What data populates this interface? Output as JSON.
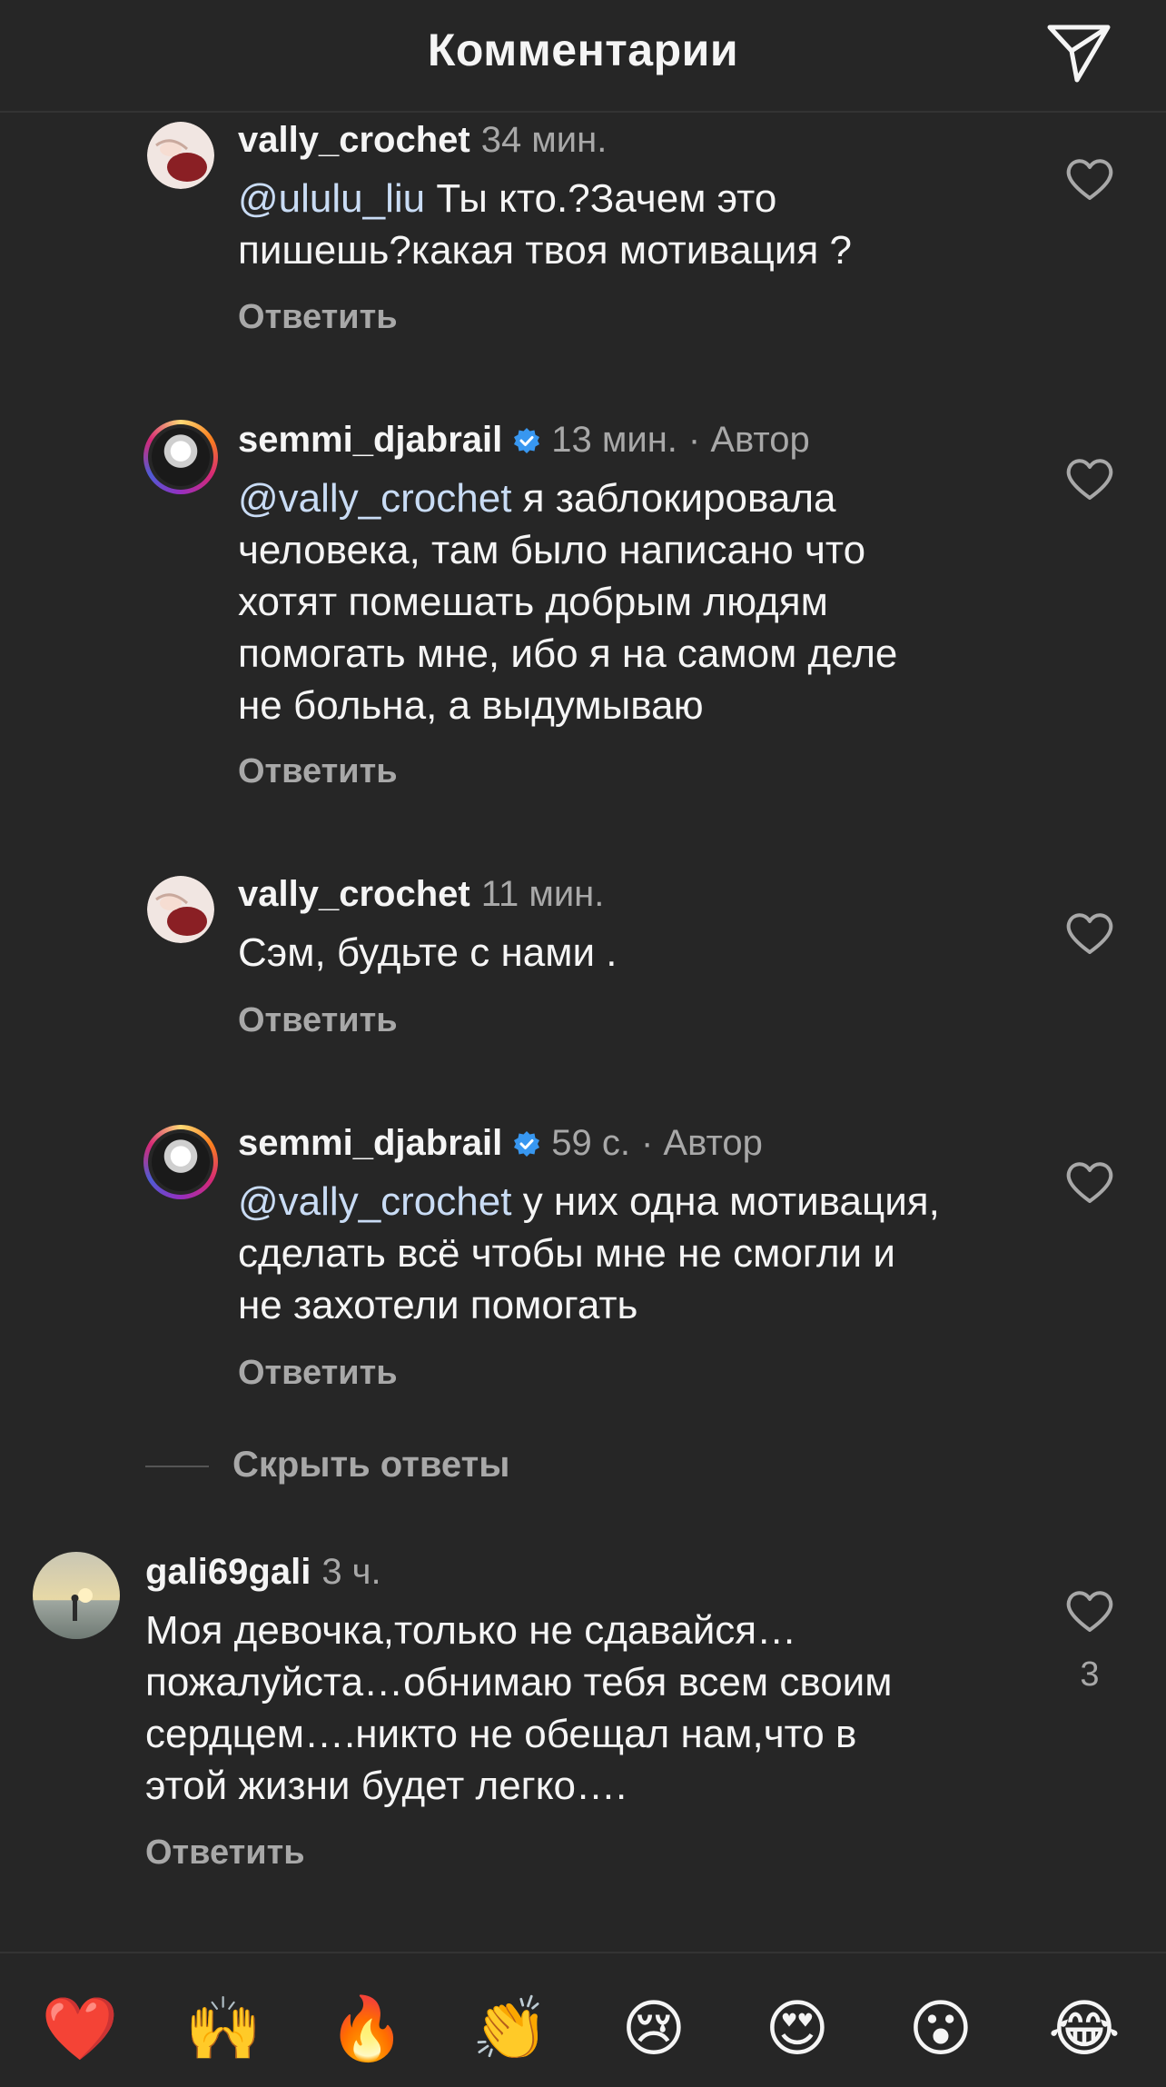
{
  "header": {
    "title": "Комментарии",
    "send_icon": "paper-plane-icon"
  },
  "comments": [
    {
      "username": "vally_crochet",
      "time": "34 мин.",
      "verified": false,
      "author_tag": "",
      "mention": "@ululu_liu",
      "lines": [
        "Ты кто.?Зачем это",
        "пишешь?какая твоя мотивация ?"
      ],
      "reply": "Ответить"
    },
    {
      "username": "semmi_djabrail",
      "time": "13 мин.",
      "verified": true,
      "author_tag": "· Автор",
      "mention": "@vally_crochet",
      "lines": [
        "я заблокировала",
        "человека, там было написано что",
        "хотят помешать добрым людям",
        "помогать мне, ибо я на самом деле",
        "не больна, а выдумываю"
      ],
      "reply": "Ответить"
    },
    {
      "username": "vally_crochet",
      "time": "11 мин.",
      "verified": false,
      "author_tag": "",
      "mention": "",
      "lines": [
        "Сэм, будьте с нами ."
      ],
      "reply": "Ответить"
    },
    {
      "username": "semmi_djabrail",
      "time": "59 с.",
      "verified": true,
      "author_tag": "· Автор",
      "mention": "@vally_crochet",
      "lines": [
        "у них одна мотивация,",
        "сделать всё чтобы мне не смогли и",
        "не захотели помогать"
      ],
      "reply": "Ответить"
    },
    {
      "username": "gali69gali",
      "time": "3 ч.",
      "verified": false,
      "author_tag": "",
      "mention": "",
      "lines": [
        "Моя девочка,только не сдавайся…",
        "пожалуйста…обнимаю тебя всем своим",
        "сердцем….никто не обещал нам,что в",
        "этой жизни будет легко…."
      ],
      "reply": "Ответить",
      "like_count": "3"
    }
  ],
  "hide_replies": "Скрыть ответы",
  "emoji_bar": [
    "❤️",
    "🙌",
    "🔥",
    "👏",
    "😢",
    "😍",
    "😮",
    "😂"
  ],
  "colors": {
    "background": "#262626",
    "mention": "#c9dcf5",
    "verified": "#3897f0",
    "muted": "#a8a8a8"
  }
}
